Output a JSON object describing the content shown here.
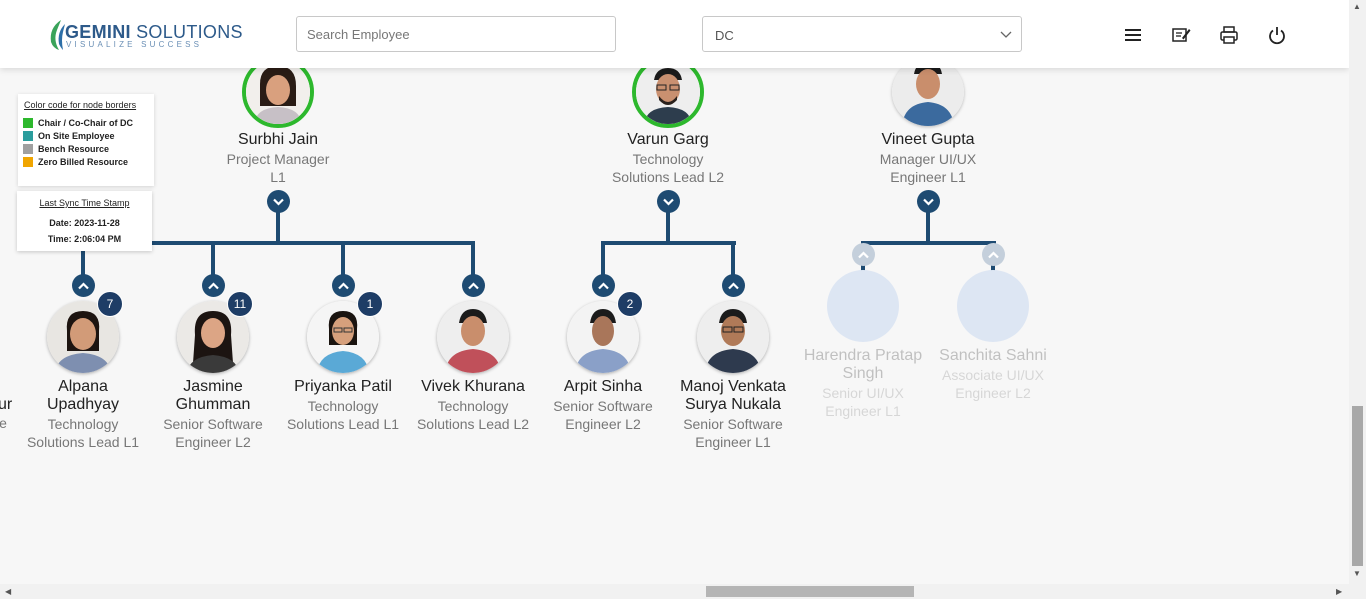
{
  "header": {
    "logo_name_bold": "GEMINI",
    "logo_name_rest": " SOLUTIONS",
    "logo_tagline": "VISUALIZE SUCCESS",
    "search_placeholder": "Search Employee",
    "dept_value": "DC",
    "icons": [
      "menu-icon",
      "edit-note-icon",
      "print-icon",
      "power-icon"
    ]
  },
  "legend": {
    "title": "Color code for node borders",
    "items": [
      {
        "label": "Chair / Co-Chair of DC",
        "color": "#2db82d"
      },
      {
        "label": "On Site Employee",
        "color": "#2a9d9d"
      },
      {
        "label": "Bench Resource",
        "color": "#a0a0a0"
      },
      {
        "label": "Zero Billed Resource",
        "color": "#f0a500"
      }
    ]
  },
  "sync": {
    "title": "Last Sync Time Stamp",
    "date": "Date: 2023-11-28",
    "time": "Time: 2:06:04 PM"
  },
  "colors": {
    "accent": "#1e4b72",
    "badge": "#1e3d66",
    "chair_border": "#2db82d"
  },
  "managers": [
    {
      "name": "Surbhi Jain",
      "role1": "Project Manager",
      "role2": "L1",
      "border": "chair"
    },
    {
      "name": "Varun Garg",
      "role1": "Technology",
      "role2": "Solutions Lead L2",
      "border": "chair"
    },
    {
      "name": "Vineet Gupta",
      "role1": "Manager UI/UX",
      "role2": "Engineer L1",
      "border": "none"
    }
  ],
  "partial_left": {
    "name": "ur",
    "role": "e"
  },
  "reports": [
    {
      "name1": "Alpana",
      "name2": "Upadhyay",
      "role1": "Technology",
      "role2": "Solutions Lead L1",
      "badge": "7"
    },
    {
      "name1": "Jasmine",
      "name2": "Ghumman",
      "role1": "Senior Software",
      "role2": "Engineer L2",
      "badge": "11"
    },
    {
      "name1": "Priyanka Patil",
      "name2": "",
      "role1": "Technology",
      "role2": "Solutions Lead L1",
      "badge": "1"
    },
    {
      "name1": "Vivek Khurana",
      "name2": "",
      "role1": "Technology",
      "role2": "Solutions Lead L2",
      "badge": ""
    },
    {
      "name1": "Arpit Sinha",
      "name2": "",
      "role1": "Senior Software",
      "role2": "Engineer L2",
      "badge": "2"
    },
    {
      "name1": "Manoj Venkata",
      "name2": "Surya Nukala",
      "role1": "Senior Software",
      "role2": "Engineer L1",
      "badge": ""
    },
    {
      "name1": "Harendra Pratap",
      "name2": "Singh",
      "role1": "Senior UI/UX",
      "role2": "Engineer L1",
      "badge": ""
    },
    {
      "name1": "Sanchita Sahni",
      "name2": "",
      "role1": "Associate UI/UX",
      "role2": "Engineer L2",
      "badge": ""
    }
  ]
}
